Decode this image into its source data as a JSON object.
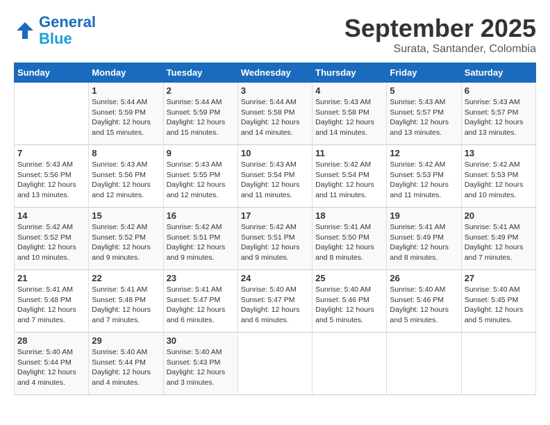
{
  "header": {
    "logo_line1": "General",
    "logo_line2": "Blue",
    "month": "September 2025",
    "location": "Surata, Santander, Colombia"
  },
  "weekdays": [
    "Sunday",
    "Monday",
    "Tuesday",
    "Wednesday",
    "Thursday",
    "Friday",
    "Saturday"
  ],
  "weeks": [
    [
      {
        "day": "",
        "info": ""
      },
      {
        "day": "1",
        "info": "Sunrise: 5:44 AM\nSunset: 5:59 PM\nDaylight: 12 hours\nand 15 minutes."
      },
      {
        "day": "2",
        "info": "Sunrise: 5:44 AM\nSunset: 5:59 PM\nDaylight: 12 hours\nand 15 minutes."
      },
      {
        "day": "3",
        "info": "Sunrise: 5:44 AM\nSunset: 5:58 PM\nDaylight: 12 hours\nand 14 minutes."
      },
      {
        "day": "4",
        "info": "Sunrise: 5:43 AM\nSunset: 5:58 PM\nDaylight: 12 hours\nand 14 minutes."
      },
      {
        "day": "5",
        "info": "Sunrise: 5:43 AM\nSunset: 5:57 PM\nDaylight: 12 hours\nand 13 minutes."
      },
      {
        "day": "6",
        "info": "Sunrise: 5:43 AM\nSunset: 5:57 PM\nDaylight: 12 hours\nand 13 minutes."
      }
    ],
    [
      {
        "day": "7",
        "info": "Sunrise: 5:43 AM\nSunset: 5:56 PM\nDaylight: 12 hours\nand 13 minutes."
      },
      {
        "day": "8",
        "info": "Sunrise: 5:43 AM\nSunset: 5:56 PM\nDaylight: 12 hours\nand 12 minutes."
      },
      {
        "day": "9",
        "info": "Sunrise: 5:43 AM\nSunset: 5:55 PM\nDaylight: 12 hours\nand 12 minutes."
      },
      {
        "day": "10",
        "info": "Sunrise: 5:43 AM\nSunset: 5:54 PM\nDaylight: 12 hours\nand 11 minutes."
      },
      {
        "day": "11",
        "info": "Sunrise: 5:42 AM\nSunset: 5:54 PM\nDaylight: 12 hours\nand 11 minutes."
      },
      {
        "day": "12",
        "info": "Sunrise: 5:42 AM\nSunset: 5:53 PM\nDaylight: 12 hours\nand 11 minutes."
      },
      {
        "day": "13",
        "info": "Sunrise: 5:42 AM\nSunset: 5:53 PM\nDaylight: 12 hours\nand 10 minutes."
      }
    ],
    [
      {
        "day": "14",
        "info": "Sunrise: 5:42 AM\nSunset: 5:52 PM\nDaylight: 12 hours\nand 10 minutes."
      },
      {
        "day": "15",
        "info": "Sunrise: 5:42 AM\nSunset: 5:52 PM\nDaylight: 12 hours\nand 9 minutes."
      },
      {
        "day": "16",
        "info": "Sunrise: 5:42 AM\nSunset: 5:51 PM\nDaylight: 12 hours\nand 9 minutes."
      },
      {
        "day": "17",
        "info": "Sunrise: 5:42 AM\nSunset: 5:51 PM\nDaylight: 12 hours\nand 9 minutes."
      },
      {
        "day": "18",
        "info": "Sunrise: 5:41 AM\nSunset: 5:50 PM\nDaylight: 12 hours\nand 8 minutes."
      },
      {
        "day": "19",
        "info": "Sunrise: 5:41 AM\nSunset: 5:49 PM\nDaylight: 12 hours\nand 8 minutes."
      },
      {
        "day": "20",
        "info": "Sunrise: 5:41 AM\nSunset: 5:49 PM\nDaylight: 12 hours\nand 7 minutes."
      }
    ],
    [
      {
        "day": "21",
        "info": "Sunrise: 5:41 AM\nSunset: 5:48 PM\nDaylight: 12 hours\nand 7 minutes."
      },
      {
        "day": "22",
        "info": "Sunrise: 5:41 AM\nSunset: 5:48 PM\nDaylight: 12 hours\nand 7 minutes."
      },
      {
        "day": "23",
        "info": "Sunrise: 5:41 AM\nSunset: 5:47 PM\nDaylight: 12 hours\nand 6 minutes."
      },
      {
        "day": "24",
        "info": "Sunrise: 5:40 AM\nSunset: 5:47 PM\nDaylight: 12 hours\nand 6 minutes."
      },
      {
        "day": "25",
        "info": "Sunrise: 5:40 AM\nSunset: 5:46 PM\nDaylight: 12 hours\nand 5 minutes."
      },
      {
        "day": "26",
        "info": "Sunrise: 5:40 AM\nSunset: 5:46 PM\nDaylight: 12 hours\nand 5 minutes."
      },
      {
        "day": "27",
        "info": "Sunrise: 5:40 AM\nSunset: 5:45 PM\nDaylight: 12 hours\nand 5 minutes."
      }
    ],
    [
      {
        "day": "28",
        "info": "Sunrise: 5:40 AM\nSunset: 5:44 PM\nDaylight: 12 hours\nand 4 minutes."
      },
      {
        "day": "29",
        "info": "Sunrise: 5:40 AM\nSunset: 5:44 PM\nDaylight: 12 hours\nand 4 minutes."
      },
      {
        "day": "30",
        "info": "Sunrise: 5:40 AM\nSunset: 5:43 PM\nDaylight: 12 hours\nand 3 minutes."
      },
      {
        "day": "",
        "info": ""
      },
      {
        "day": "",
        "info": ""
      },
      {
        "day": "",
        "info": ""
      },
      {
        "day": "",
        "info": ""
      }
    ]
  ]
}
